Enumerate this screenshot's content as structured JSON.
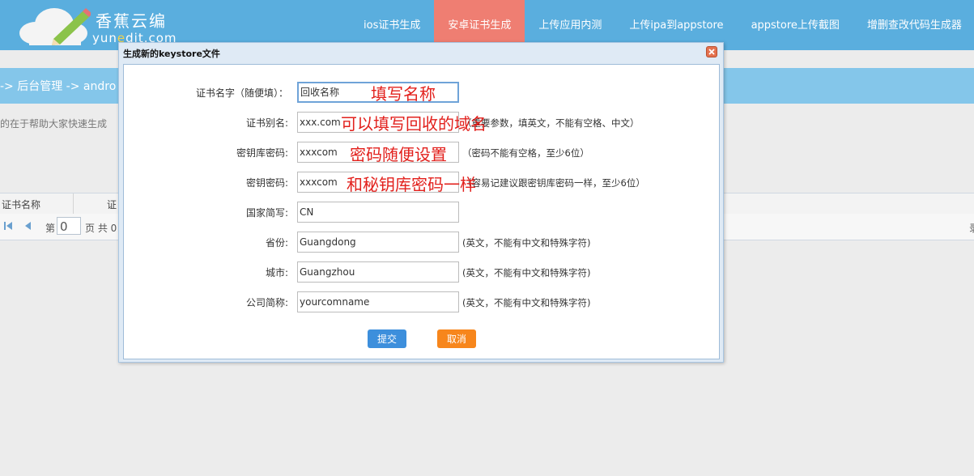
{
  "brand": {
    "title": "香蕉云编",
    "sub_pre": "yun",
    "sub_hl": "e",
    "sub_post": "dit.com",
    "icon": "cloud-pencil-logo"
  },
  "nav": {
    "items": [
      {
        "label": "ios证书生成",
        "active": false
      },
      {
        "label": "安卓证书生成",
        "active": true
      },
      {
        "label": "上传应用内测",
        "active": false
      },
      {
        "label": "上传ipa到appstore",
        "active": false
      },
      {
        "label": "appstore上传截图",
        "active": false
      },
      {
        "label": "增删查改代码生成器",
        "active": false
      }
    ]
  },
  "breadcrumb": "-> 后台管理 -> andro",
  "intro": "的在于帮助大家快速生成",
  "grid": {
    "col1": "证书名称",
    "col2": "证"
  },
  "pager": {
    "page_label": "第",
    "page_value": "0",
    "of_label": "页 共 0",
    "right_text": "录"
  },
  "dialog": {
    "title": "生成新的keystore文件",
    "fields": [
      {
        "label": "证书名字（随便填）：",
        "value": "回收名称",
        "hint": ""
      },
      {
        "label": "证书别名:",
        "value": "xxx.com",
        "hint": "（重要参数，填英文，不能有空格、中文）"
      },
      {
        "label": "密钥库密码:",
        "value": "xxxcom",
        "hint": "（密码不能有空格，至少6位）"
      },
      {
        "label": "密钥密码:",
        "value": "xxxcom",
        "hint": "（容易记建议跟密钥库密码一样，至少6位）"
      },
      {
        "label": "国家简写:",
        "value": "CN",
        "hint": ""
      },
      {
        "label": "省份:",
        "value": "Guangdong",
        "hint": "(英文，不能有中文和特殊字符)"
      },
      {
        "label": "城市:",
        "value": "Guangzhou",
        "hint": "(英文，不能有中文和特殊字符)"
      },
      {
        "label": "公司简称:",
        "value": "yourcomname",
        "hint": "(英文，不能有中文和特殊字符)"
      }
    ],
    "submit_label": "提交",
    "cancel_label": "取消"
  },
  "annotations": [
    "填写名称",
    "可以填写回收的域名",
    "密码随便设置",
    "和秘钥库密码一样"
  ],
  "colors": {
    "header": "#5aaede",
    "active_tab": "#ef7e72",
    "submit": "#3d8fdc",
    "cancel": "#f7861c",
    "annotation": "#e2201c"
  }
}
